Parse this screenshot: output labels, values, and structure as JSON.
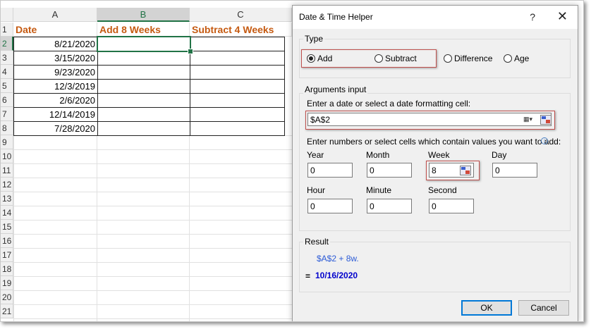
{
  "sheet": {
    "columns": [
      "A",
      "B",
      "C"
    ],
    "rows": [
      "1",
      "2",
      "3",
      "4",
      "5",
      "6",
      "7",
      "8",
      "9",
      "10",
      "11",
      "12",
      "13",
      "14",
      "15",
      "16",
      "17",
      "18",
      "19",
      "20",
      "21"
    ],
    "headers": [
      "Date",
      "Add 8 Weeks",
      "Subtract 4 Weeks"
    ],
    "dates": [
      "8/21/2020",
      "3/15/2020",
      "9/23/2020",
      "12/3/2019",
      "2/6/2020",
      "12/14/2019",
      "7/28/2020"
    ]
  },
  "dialog": {
    "title": "Date & Time Helper",
    "help": "?",
    "close": "✕",
    "type_group": "Type",
    "types": [
      "Add",
      "Subtract",
      "Difference",
      "Age"
    ],
    "selected_type": "Add",
    "args_group": "Arguments input",
    "date_prompt": "Enter a date or select a date formatting cell:",
    "date_value": "$A$2",
    "numbers_prompt": "Enter numbers or select cells which contain values you want to add:",
    "fields": {
      "year": {
        "label": "Year",
        "value": "0"
      },
      "month": {
        "label": "Month",
        "value": "0"
      },
      "week": {
        "label": "Week",
        "value": "8"
      },
      "day": {
        "label": "Day",
        "value": "0"
      },
      "hour": {
        "label": "Hour",
        "value": "0"
      },
      "minute": {
        "label": "Minute",
        "value": "0"
      },
      "second": {
        "label": "Second",
        "value": "0"
      }
    },
    "result_group": "Result",
    "formula": "$A$2 + 8w.",
    "equals": "=",
    "result_value": "10/16/2020",
    "ok": "OK",
    "cancel": "Cancel"
  },
  "colors": {
    "header_text": "#c55a11",
    "excel_green": "#217346",
    "highlight_red": "#c0504d",
    "formula_blue": "#2c5bd6",
    "result_blue": "#0000cc"
  }
}
